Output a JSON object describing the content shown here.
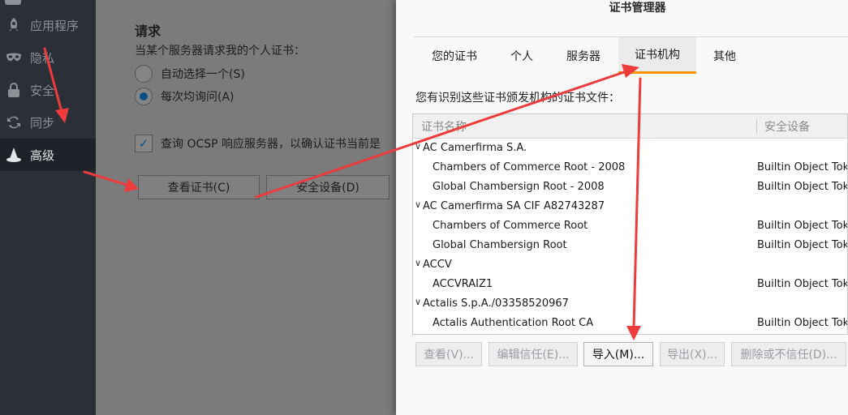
{
  "sidebar": {
    "items": [
      {
        "label": "应用程序",
        "icon": "rocket-icon"
      },
      {
        "label": "隐私",
        "icon": "mask-icon"
      },
      {
        "label": "安全",
        "icon": "lock-icon"
      },
      {
        "label": "同步",
        "icon": "sync-icon"
      },
      {
        "label": "高级",
        "icon": "wizard-hat-icon",
        "active": true
      }
    ]
  },
  "prefs": {
    "requests_heading": "请求",
    "requests_desc": "当某个服务器请求我的个人证书：",
    "radio_auto": "自动选择一个(S)",
    "radio_ask": "每次均询问(A)",
    "ocsp_checkbox": "查询 OCSP 响应服务器，以确认证书当前是",
    "view_certs_button": "查看证书(C)",
    "security_devices_button": "安全设备(D)"
  },
  "dialog": {
    "title": "证书管理器",
    "tabs": [
      "您的证书",
      "个人",
      "服务器",
      "证书机构",
      "其他"
    ],
    "selected_tab": "证书机构",
    "caption": "您有识别这些证书颁发机构的证书文件：",
    "columns": {
      "name": "证书名称",
      "device": "安全设备"
    },
    "rows": [
      {
        "type": "group",
        "name": "AC Camerfirma S.A."
      },
      {
        "type": "cert",
        "name": "Chambers of Commerce Root - 2008",
        "device": "Builtin Object Token"
      },
      {
        "type": "cert",
        "name": "Global Chambersign Root - 2008",
        "device": "Builtin Object Token"
      },
      {
        "type": "group",
        "name": "AC Camerfirma SA CIF A82743287"
      },
      {
        "type": "cert",
        "name": "Chambers of Commerce Root",
        "device": "Builtin Object Token"
      },
      {
        "type": "cert",
        "name": "Global Chambersign Root",
        "device": "Builtin Object Token"
      },
      {
        "type": "group",
        "name": "ACCV"
      },
      {
        "type": "cert",
        "name": "ACCVRAIZ1",
        "device": "Builtin Object Token"
      },
      {
        "type": "group",
        "name": "Actalis S.p.A./03358520967"
      },
      {
        "type": "cert",
        "name": "Actalis Authentication Root CA",
        "device": "Builtin Object Token"
      }
    ],
    "buttons": {
      "view": "查看(V)...",
      "edit_trust": "编辑信任(E)...",
      "import": "导入(M)...",
      "export": "导出(X)...",
      "delete": "删除或不信任(D)..."
    }
  },
  "colors": {
    "annotation_arrow": "#ee3b3b",
    "tab_accent": "#ff9400",
    "sidebar_bg": "#2b2f37"
  }
}
